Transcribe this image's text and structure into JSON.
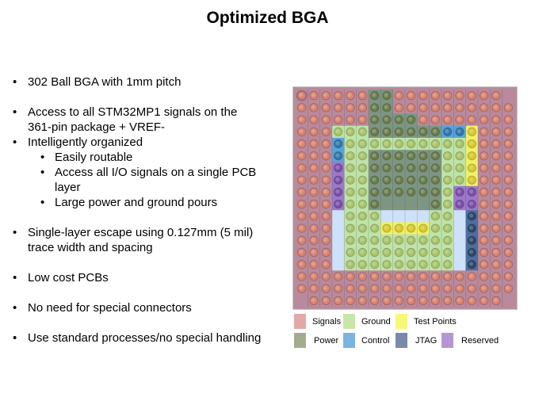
{
  "title": "Optimized BGA",
  "bullets": [
    {
      "type": "bullet",
      "text": "302 Ball BGA with 1mm pitch"
    },
    {
      "type": "gap"
    },
    {
      "type": "bullet",
      "text": "Access to all STM32MP1 signals on the"
    },
    {
      "type": "cont",
      "text": "361-pin package + VREF-"
    },
    {
      "type": "bullet",
      "text": ""
    },
    {
      "type": "cont",
      "text": "Intelligently  organized"
    },
    {
      "type": "sub",
      "text": "Easily routable"
    },
    {
      "type": "sub",
      "text": "Access all I/O  signals on a single PCB"
    },
    {
      "type": "subcont",
      "text": "layer"
    },
    {
      "type": "sub",
      "text": "Large power and ground pours"
    },
    {
      "type": "gap"
    },
    {
      "type": "bullet",
      "text": "Single-layer escape using 0.127mm (5 mil)"
    },
    {
      "type": "cont",
      "text": "trace width and spacing"
    },
    {
      "type": "gap"
    },
    {
      "type": "bullet",
      "text": "Low cost PCBs"
    },
    {
      "type": "gap"
    },
    {
      "type": "bullet",
      "text": "No need for special connectors"
    },
    {
      "type": "gap"
    },
    {
      "type": "bullet",
      "text": "Use standard processes/no special handling"
    }
  ],
  "bga_map": {
    "columns": 18,
    "rows": 18,
    "key": {
      "S": "Signals",
      "P": "Power",
      "G": "Ground",
      "C": "Control",
      "T": "Test Points",
      "J": "JTAG",
      "R": "Reserved",
      "E": "Empty (unused area)",
      "N": "No ball",
      "X": "No ball (power pour)"
    },
    "grid": [
      "SSSSSSPPSSSSSSSSSN",
      "SSSSSSPPSSSSSSSSSS",
      "SSSSSSPPPPSSSSSSSS",
      "SSSGGGPPPPPPCCTSSS",
      "SSSCGGGGGGGGGGTSSS",
      "SSSCGGPPPPPPGGTSSS",
      "SSSRGGPPPPPPGGTSSS",
      "SSSRGGPPPPPPGGTSSS",
      "SSSRGGPPPPPPGRRSSS",
      "SSSRGGPXXXXPGRRSSS",
      "SSSEGGGEEEEGGEJSSS",
      "SSSEGGGTTTTGGEJSSS",
      "SSSEGGGGGGGGGEJSSS",
      "SSSEGGGGGGGGGEJSSS",
      "SSSEGGGGGGGGGEJSSS",
      "SSSSSSSSSSSSSSSSSS",
      "SSSSSSSSSSSSSSSSSS",
      "NSSSSSSSSSSSSSSSSN"
    ]
  },
  "colors": {
    "S": {
      "fill": "#b98a9c",
      "ball": "#d9826e"
    },
    "P": {
      "fill": "#7d9683",
      "ball": "#6a7d4a"
    },
    "G": {
      "fill": "#bfe3a8",
      "ball": "#a8c468"
    },
    "C": {
      "fill": "#5aa3d8",
      "ball": "#2f78a8"
    },
    "T": {
      "fill": "#f1f169",
      "ball": "#d6c92c"
    },
    "J": {
      "fill": "#4d6f9e",
      "ball": "#2d4668"
    },
    "R": {
      "fill": "#9c78c9",
      "ball": "#7a4fa8"
    },
    "E": {
      "fill": "#cfe0fa",
      "ball": null
    },
    "X": {
      "fill": "#7d9683",
      "ball": null
    },
    "N": {
      "fill": "#b98a9c",
      "ball": null
    }
  },
  "legend": [
    {
      "label": "Signals",
      "color": "#e2a8a8"
    },
    {
      "label": "Ground",
      "color": "#c8e6a8"
    },
    {
      "label": "Test Points",
      "color": "#f8f878"
    },
    {
      "label": "Power",
      "color": "#a3ad8e"
    },
    {
      "label": "Control",
      "color": "#7ab4e0"
    },
    {
      "label": "JTAG",
      "color": "#7a8aaa"
    },
    {
      "label": "Reserved",
      "color": "#b496d0"
    }
  ]
}
